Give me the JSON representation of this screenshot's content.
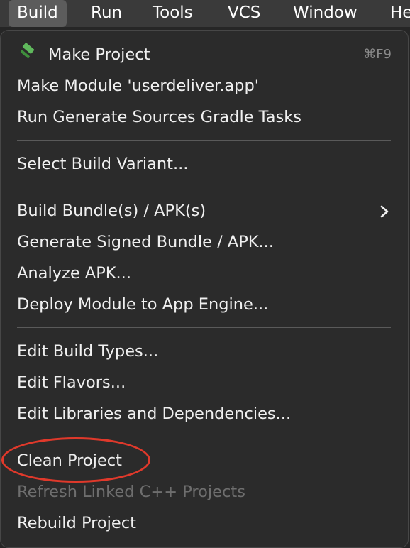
{
  "menubar": {
    "items": [
      {
        "label": "Build",
        "active": true
      },
      {
        "label": "Run"
      },
      {
        "label": "Tools"
      },
      {
        "label": "VCS"
      },
      {
        "label": "Window"
      },
      {
        "label": "He"
      }
    ]
  },
  "dropdown": {
    "make_project": {
      "label": "Make Project",
      "icon": "hammer-icon",
      "shortcut": "⌘F9"
    },
    "make_module": {
      "label": "Make Module 'userdeliver.app'"
    },
    "run_generate": {
      "label": "Run Generate Sources Gradle Tasks"
    },
    "select_build_variant": {
      "label": "Select Build Variant..."
    },
    "build_bundles": {
      "label": "Build Bundle(s) / APK(s)",
      "icon": "chevron-right-icon"
    },
    "generate_signed": {
      "label": "Generate Signed Bundle / APK..."
    },
    "analyze_apk": {
      "label": "Analyze APK..."
    },
    "deploy_module": {
      "label": "Deploy Module to App Engine..."
    },
    "edit_build_types": {
      "label": "Edit Build Types..."
    },
    "edit_flavors": {
      "label": "Edit Flavors..."
    },
    "edit_libraries": {
      "label": "Edit Libraries and Dependencies..."
    },
    "clean_project": {
      "label": "Clean Project"
    },
    "refresh_linked": {
      "label": "Refresh Linked C++ Projects",
      "disabled": true
    },
    "rebuild_project": {
      "label": "Rebuild Project"
    }
  },
  "colors": {
    "menubar_bg": "#3a3a3a",
    "active_bg": "#5c5c5c",
    "dropdown_bg": "#2b2b2b",
    "text": "#f0f0f0",
    "disabled_text": "#6e6e6e",
    "annotation": "#e0392b",
    "hammer_green": "#5fb85c"
  }
}
